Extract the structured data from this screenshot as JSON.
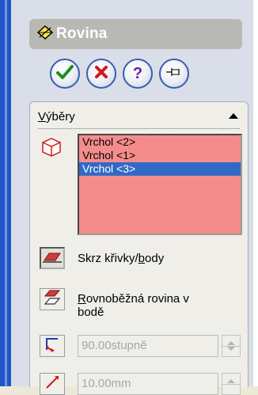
{
  "feature": {
    "title": "Rovina"
  },
  "buttons": {
    "ok_icon": "check-icon",
    "cancel_icon": "x-icon",
    "help_label": "?",
    "pin_icon": "pushpin-icon"
  },
  "selections": {
    "header_prefix": "V",
    "header_rest": "ýběry",
    "items": [
      {
        "label": "Vrchol <2>",
        "selected": false
      },
      {
        "label": "Vrchol <1>",
        "selected": false
      },
      {
        "label": "Vrchol <3>",
        "selected": true
      }
    ]
  },
  "options": {
    "through_curves": {
      "label_pre": "Skrz křivky/",
      "label_u": "b",
      "label_post": "ody"
    },
    "parallel_plane": {
      "label_u": "R",
      "label_line1": "ovnoběžná rovina v",
      "label_line2": "bodě"
    }
  },
  "angle": {
    "value": "90.00stupně"
  },
  "distance": {
    "value": "10.00mm"
  },
  "colors": {
    "list_bg": "#f58c8c",
    "selected_bg": "#316ac5",
    "ok_green": "#1a8f1a",
    "cancel_red": "#d11a1a",
    "help_purple": "#6a1aa8"
  }
}
